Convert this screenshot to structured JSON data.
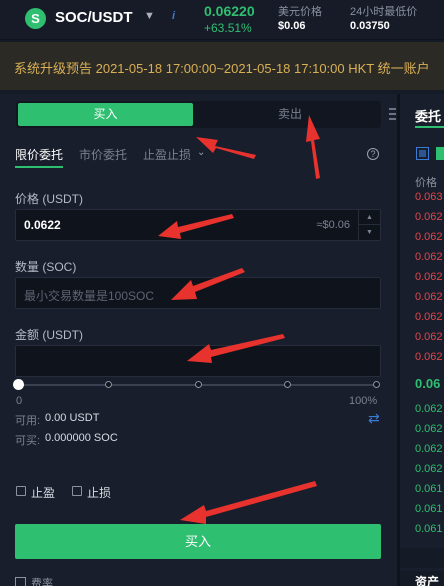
{
  "header": {
    "logo_letter": "S",
    "pair": "SOC/USDT",
    "last_price": "0.06220",
    "change_pct": "+63.51%",
    "usd_label": "美元价格",
    "usd_value": "$0.06",
    "low_label": "24小时最低价",
    "low_value": "0.03750",
    "accent_green": "#2fbf71",
    "accent_red": "#e0474c"
  },
  "notice": {
    "text": "系统升级预告   2021-05-18 17:00:00~2021-05-18 17:10:00 HKT 统一账户"
  },
  "trade": {
    "buy_tab": "买入",
    "sell_tab": "卖出",
    "order_types": [
      "限价委托",
      "市价委托",
      "止盈止损"
    ],
    "price_label": "价格 (USDT)",
    "price_value": "0.0622",
    "price_hint": "≈$0.06",
    "amount_label": "数量 (SOC)",
    "amount_placeholder": "最小交易数量是100SOC",
    "total_label": "金额 (USDT)",
    "slider_value": 0,
    "slider_min_label": "0",
    "slider_max_label": "100%",
    "available_label": "可用:",
    "available_value": "0.00 USDT",
    "max_buy_label": "可买:",
    "max_buy_value": "0.000000 SOC",
    "take_profit_label": "止盈",
    "stop_loss_label": "止损",
    "submit_label": "买入",
    "fee_label": "费率"
  },
  "orderbook": {
    "title": "委托",
    "price_header": "价格",
    "asks": [
      "0.063",
      "0.062",
      "0.062",
      "0.062",
      "0.062",
      "0.062",
      "0.062",
      "0.062",
      "0.062"
    ],
    "last": "0.06",
    "bids": [
      "0.062",
      "0.062",
      "0.062",
      "0.062",
      "0.061",
      "0.061",
      "0.061"
    ],
    "bottom_title": "资产"
  },
  "icons": {
    "logo": "soc-logo-icon",
    "pair_chevron": "chevron-down-icon",
    "info": "info-icon",
    "help": "help-circle-icon",
    "swap": "swap-arrows-icon",
    "annotation": "red-arrow-annotation"
  }
}
